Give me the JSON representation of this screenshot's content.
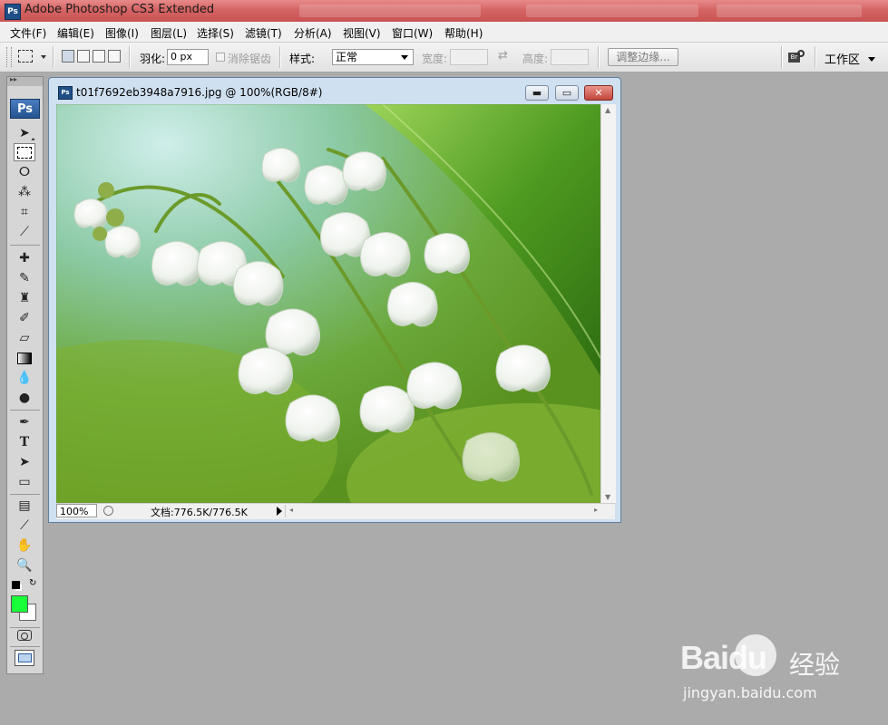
{
  "window": {
    "title": "Adobe Photoshop CS3 Extended",
    "app_icon": "Ps"
  },
  "menu": [
    "文件(F)",
    "编辑(E)",
    "图像(I)",
    "图层(L)",
    "选择(S)",
    "滤镜(T)",
    "分析(A)",
    "视图(V)",
    "窗口(W)",
    "帮助(H)"
  ],
  "options": {
    "feather_label": "羽化:",
    "feather_value": "0 px",
    "antialias_label": "消除锯齿",
    "style_label": "样式:",
    "style_value": "正常",
    "width_label": "宽度:",
    "height_label": "高度:",
    "refine_edge_label": "调整边缘...",
    "workspace_label": "工作区",
    "bridge_label": "Br"
  },
  "toolbox": {
    "ps_label": "Ps",
    "tools": [
      "move-tool",
      "marquee-tool",
      "lasso-tool",
      "magic-wand-tool",
      "crop-tool",
      "slice-tool",
      "healing-brush-tool",
      "brush-tool",
      "clone-stamp-tool",
      "history-brush-tool",
      "eraser-tool",
      "gradient-tool",
      "blur-tool",
      "dodge-tool",
      "pen-tool",
      "type-tool",
      "path-selection-tool",
      "rectangle-tool",
      "notes-tool",
      "eyedropper-tool",
      "hand-tool",
      "zoom-tool"
    ],
    "foreground_color": "#19ff3a",
    "background_color": "#ffffff"
  },
  "document": {
    "title": "t01f7692eb3948a7916.jpg @ 100%(RGB/8#)",
    "zoom": "100%",
    "doc_info": "文档:776.5K/776.5K",
    "minimize": "▬",
    "maximize": "▭",
    "close": "✕"
  },
  "watermark": {
    "brand": "Baidu",
    "brand_cn": "经验",
    "url": "jingyan.baidu.com"
  },
  "colors": {
    "titlebar": "#d56464",
    "workspace_bg": "#ababab",
    "accent": "#1f4f86"
  }
}
